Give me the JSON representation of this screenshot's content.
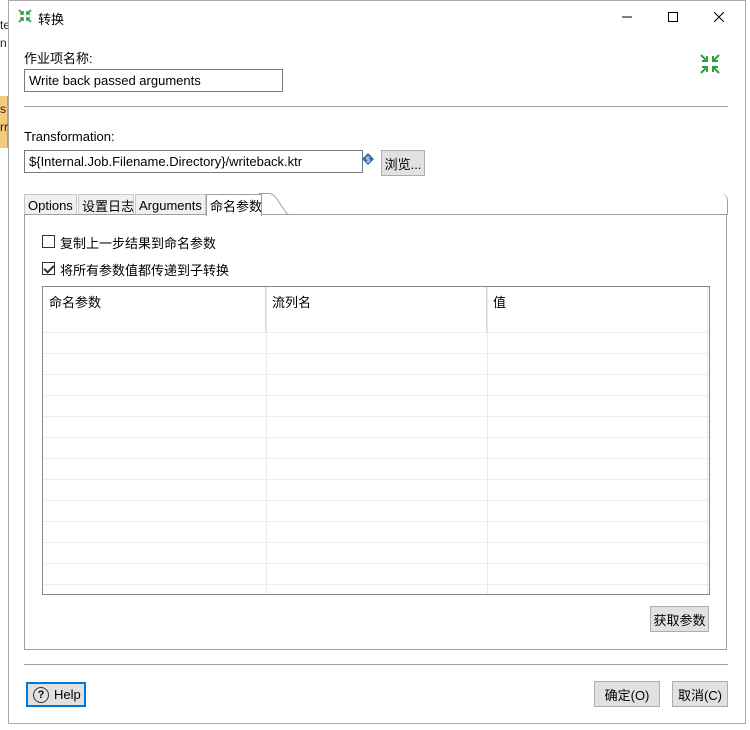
{
  "window": {
    "title": "转换",
    "minimize_icon": "minimize-icon",
    "maximize_icon": "maximize-icon",
    "close_icon": "close-icon"
  },
  "background": {
    "texts": [
      "te",
      "n",
      "s",
      "rr"
    ]
  },
  "form": {
    "job_name_label": "作业项名称:",
    "job_name_value": "Write back passed arguments",
    "transformation_label": "Transformation:",
    "transformation_value": "${Internal.Job.Filename.Directory}/writeback.ktr",
    "browse_button": "浏览..."
  },
  "tabs": [
    {
      "label": "Options",
      "active": false
    },
    {
      "label": "设置日志",
      "active": false
    },
    {
      "label": "Arguments",
      "active": false
    },
    {
      "label": "命名参数",
      "active": true
    }
  ],
  "named_params": {
    "copy_previous_label": "复制上一步结果到命名参数",
    "copy_previous_checked": false,
    "pass_all_label": "将所有参数值都传递到子转换",
    "pass_all_checked": true,
    "columns": [
      "命名参数",
      "流列名",
      "值"
    ],
    "rows": [],
    "get_params_button": "获取参数"
  },
  "footer": {
    "help_button": "Help",
    "ok_button": "确定(O)",
    "cancel_button": "取消(C)"
  },
  "colors": {
    "accent": "#0078d7",
    "icon_green": "#2e9e3e",
    "button_bg": "#e1e1e1",
    "separator": "#a0a0a0"
  }
}
